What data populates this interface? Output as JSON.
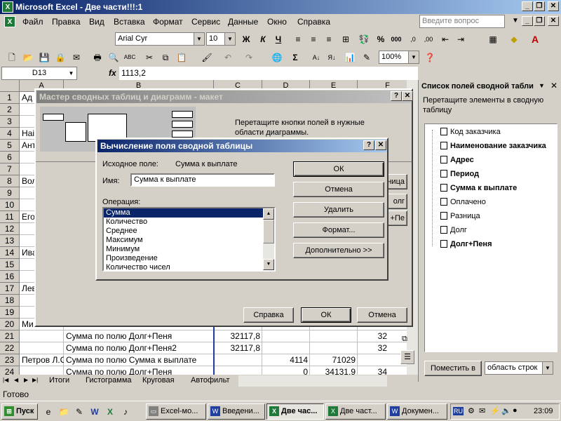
{
  "window": {
    "title": "Microsoft Excel - Две части!!!:1",
    "app_icon": "X"
  },
  "menu": {
    "items": [
      "Файл",
      "Правка",
      "Вид",
      "Вставка",
      "Формат",
      "Сервис",
      "Данные",
      "Окно",
      "Справка"
    ],
    "help_placeholder": "Введите вопрос"
  },
  "format_toolbar": {
    "font": "Arial Cyr",
    "size": "10",
    "bold": "Ж",
    "italic": "К",
    "underline": "Ч",
    "percent": "%",
    "thousands": "000"
  },
  "std_toolbar": {
    "zoom": "100%",
    "sum": "Σ"
  },
  "formula_bar": {
    "name_box": "D13",
    "fx": "fx",
    "value": "1113,2"
  },
  "columns": [
    "A",
    "B",
    "C",
    "D",
    "E",
    "F"
  ],
  "rows": [
    "1",
    "2",
    "3",
    "4",
    "5",
    "6",
    "7",
    "8",
    "9",
    "10",
    "11",
    "12",
    "13",
    "14",
    "15",
    "16",
    "17",
    "18",
    "19",
    "20",
    "21",
    "22",
    "23",
    "24"
  ],
  "cells": {
    "a1": "Ад",
    "a4": "Наі",
    "a5": "Ант",
    "a8": "Вол",
    "a11": "Его",
    "a15": "Ива",
    "a17": "Лев",
    "a20": "Ми",
    "b21": "Сумма по полю Долг+Пеня",
    "c21": "32117,8",
    "f21": "32",
    "b22": "Сумма по полю Долг+Пеня2",
    "c22": "32117,8",
    "f22": "32",
    "a23": "Петров Л.С",
    "b23": "Сумма по полю Сумма к выплате",
    "d23": "4114",
    "e23": "71029",
    "b24": "Сумма по полю Долг+Пеня",
    "d24": "0",
    "e24": "34131,9",
    "f24": "34"
  },
  "sheet_tabs": [
    "Итоги",
    "Гистограмма",
    "Круговая",
    "Автофильт"
  ],
  "wizard": {
    "title": "Мастер сводных таблиц и диаграмм - макет",
    "instructions": "Перетащите кнопки полей в нужные области диаграммы.",
    "help": "Справка",
    "ok": "ОК",
    "cancel": "Отмена",
    "side_buttons": [
      "ница",
      "олг",
      "+Пе"
    ]
  },
  "calc_dialog": {
    "title": "Вычисление поля сводной таблицы",
    "source_label": "Исходное поле:",
    "source_value": "Сумма к выплате",
    "name_label": "Имя:",
    "name_value": "Сумма  к выплате",
    "operation_label": "Операция:",
    "operations": [
      "Сумма",
      "Количество",
      "Среднее",
      "Максимум",
      "Минимум",
      "Произведение",
      "Количество чисел"
    ],
    "selected": 0,
    "ok": "ОК",
    "cancel": "Отмена",
    "delete": "Удалить",
    "format": "Формат...",
    "more": "Дополнительно >>"
  },
  "field_list": {
    "title": "Список полей сводной табли",
    "instruction": "Перетащите элементы в сводную таблицу",
    "fields": [
      {
        "label": "Код заказчика",
        "bold": false
      },
      {
        "label": "Наименование заказчика",
        "bold": true
      },
      {
        "label": "Адрес",
        "bold": true
      },
      {
        "label": "Период",
        "bold": true
      },
      {
        "label": "Сумма к выплате",
        "bold": true
      },
      {
        "label": "Оплачено",
        "bold": false
      },
      {
        "label": "Разница",
        "bold": false
      },
      {
        "label": "Долг",
        "bold": false
      },
      {
        "label": "Долг+Пеня",
        "bold": true
      }
    ],
    "place_button": "Поместить в",
    "area": "область строк"
  },
  "status": {
    "text": "Готово"
  },
  "taskbar": {
    "start": "Пуск",
    "tasks": [
      "Excel-мо...",
      "Введени...",
      "Две час...",
      "Две част...",
      "Докумен..."
    ],
    "lang": "RU",
    "clock": "23:09"
  },
  "colors": {
    "title_active": "#0a246a",
    "title_gradient": "#a6caf0",
    "selection": "#0a246a"
  }
}
